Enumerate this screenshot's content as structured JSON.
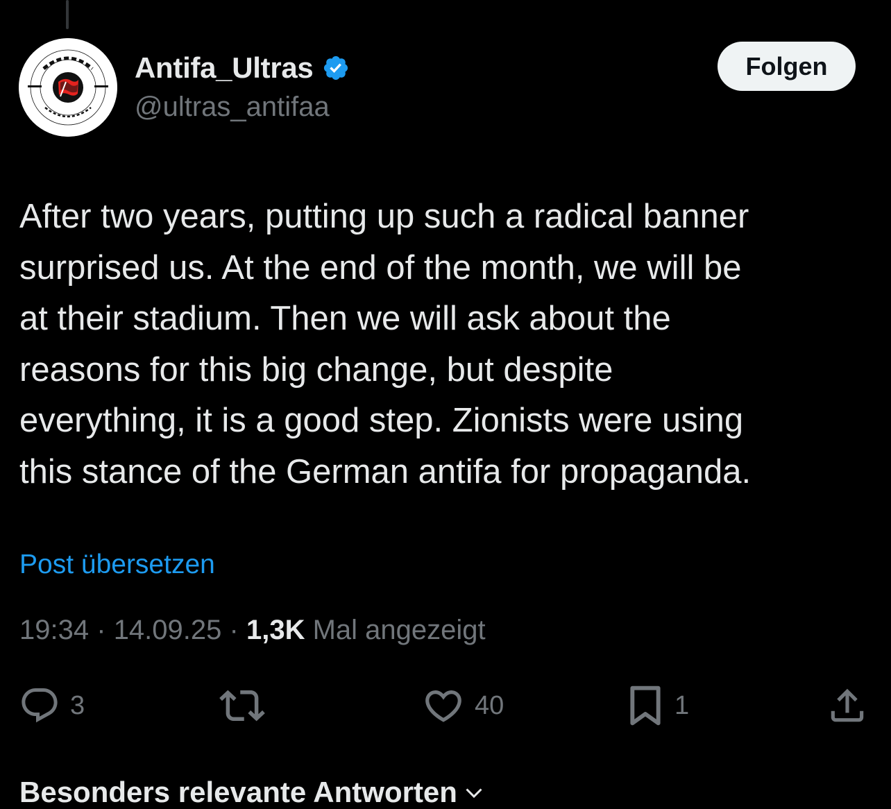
{
  "post": {
    "author": {
      "display_name": "Antifa_Ultras",
      "handle": "@ultras_antifaa",
      "verified": true,
      "avatar_icon": "antifa-ultras-logo"
    },
    "follow_label": "Folgen",
    "text": "After two years, putting up such a radical banner\nsurprised us. At the end of the month, we will be\nat their stadium. Then we will ask about the\nreasons for this big change, but despite\neverything, it is a good step. Zionists were using\nthis stance of the German antifa for propaganda.",
    "translate_label": "Post übersetzen",
    "time": "19:34",
    "separator": "·",
    "date": "14.09.25",
    "views_count": "1,3K",
    "views_label": "Mal angezeigt",
    "actions": {
      "reply": {
        "icon": "reply-icon",
        "count": "3"
      },
      "repost": {
        "icon": "repost-icon",
        "count": ""
      },
      "like": {
        "icon": "heart-icon",
        "count": "40"
      },
      "bookmark": {
        "icon": "bookmark-icon",
        "count": "1"
      },
      "share": {
        "icon": "share-icon"
      }
    }
  },
  "replies_section": {
    "heading": "Besonders relevante Antworten"
  },
  "colors": {
    "background": "#000000",
    "text_primary": "#e7e9ea",
    "text_secondary": "#71767b",
    "accent": "#1d9bf0",
    "logo_red": "#e4231f"
  }
}
